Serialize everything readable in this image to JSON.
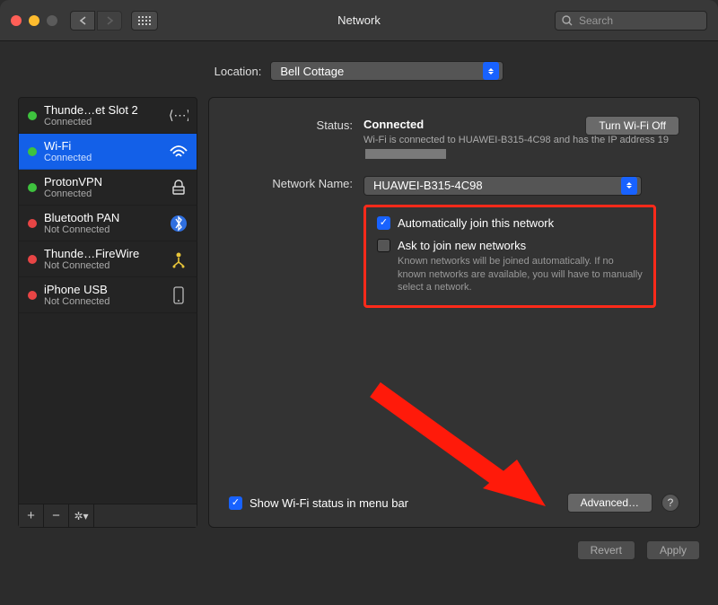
{
  "window": {
    "title": "Network",
    "search_placeholder": "Search"
  },
  "location": {
    "label": "Location:",
    "value": "Bell Cottage"
  },
  "interfaces": [
    {
      "name": "Thunde…et Slot 2",
      "status": "Connected",
      "dot": "green",
      "icon": "thunderbolt-bridge"
    },
    {
      "name": "Wi-Fi",
      "status": "Connected",
      "dot": "green",
      "icon": "wifi",
      "selected": true
    },
    {
      "name": "ProtonVPN",
      "status": "Connected",
      "dot": "green",
      "icon": "vpn"
    },
    {
      "name": "Bluetooth PAN",
      "status": "Not Connected",
      "dot": "red",
      "icon": "bluetooth"
    },
    {
      "name": "Thunde…FireWire",
      "status": "Not Connected",
      "dot": "red",
      "icon": "firewire"
    },
    {
      "name": "iPhone USB",
      "status": "Not Connected",
      "dot": "red",
      "icon": "iphone"
    }
  ],
  "detail": {
    "status_label": "Status:",
    "status_value": "Connected",
    "turn_off_label": "Turn Wi-Fi Off",
    "status_desc_prefix": "Wi-Fi is connected to HUAWEI-B315-4C98 and has the IP address 19",
    "network_name_label": "Network Name:",
    "network_name_value": "HUAWEI-B315-4C98",
    "auto_join_label": "Automatically join this network",
    "ask_join_label": "Ask to join new networks",
    "ask_join_help": "Known networks will be joined automatically. If no known networks are available, you will have to manually select a network.",
    "show_status_label": "Show Wi-Fi status in menu bar",
    "advanced_label": "Advanced…",
    "help_label": "?"
  },
  "footer": {
    "revert": "Revert",
    "apply": "Apply"
  }
}
